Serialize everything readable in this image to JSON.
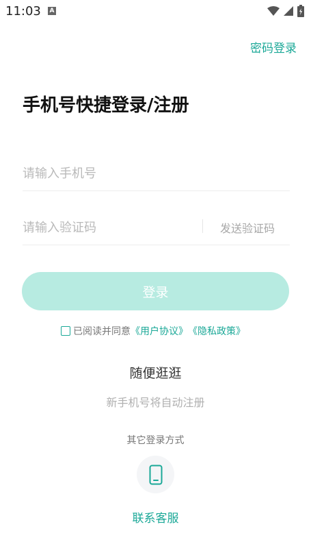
{
  "status_bar": {
    "time": "11:03",
    "notif": "A"
  },
  "header": {
    "password_login": "密码登录"
  },
  "title": "手机号快捷登录/注册",
  "phone": {
    "placeholder": "请输入手机号",
    "value": ""
  },
  "code": {
    "placeholder": "请输入验证码",
    "value": "",
    "send_label": "发送验证码"
  },
  "login_button": "登录",
  "agreement": {
    "prefix": "已阅读并同意",
    "user_agreement": "《用户协议》",
    "privacy_policy": "《隐私政策》"
  },
  "browse_label": "随便逛逛",
  "auto_register_note": "新手机号将自动注册",
  "other_methods_label": "其它登录方式",
  "contact_service": "联系客服",
  "colors": {
    "accent": "#1aa897",
    "button_disabled": "#b7ebe1"
  }
}
